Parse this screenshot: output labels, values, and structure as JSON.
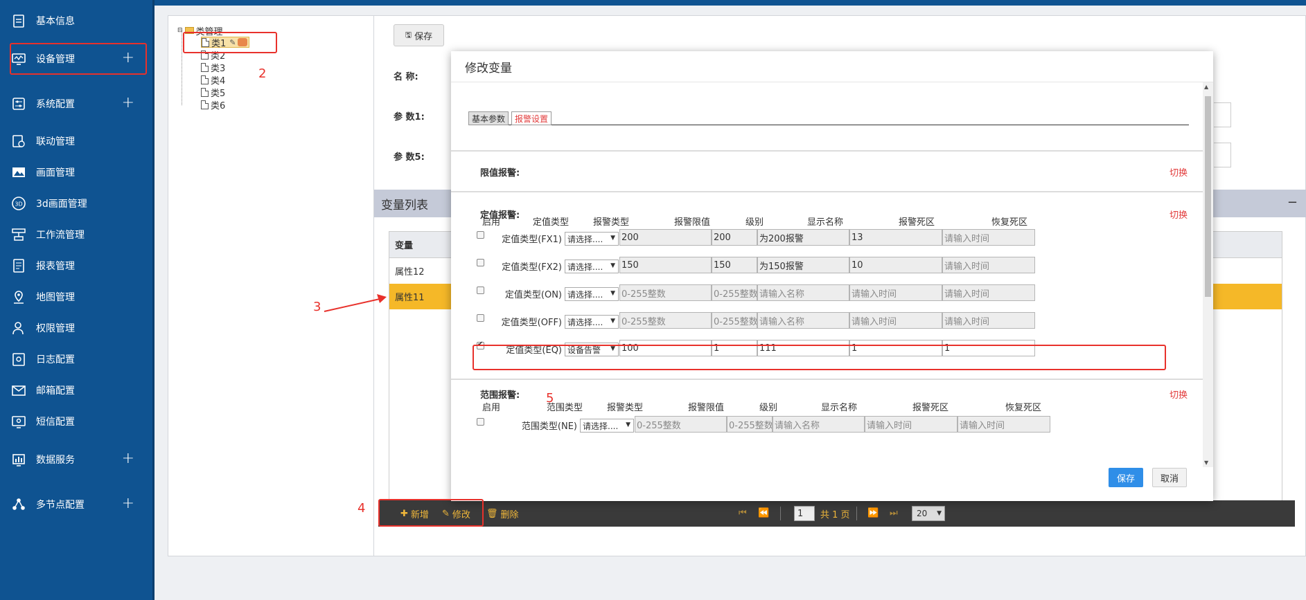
{
  "sidebar": {
    "items": [
      {
        "label": "基本信息",
        "icon": "calendar-icon",
        "plus": ""
      },
      {
        "label": "设备管理",
        "icon": "monitor-icon",
        "plus": "+"
      },
      {
        "label": "系统配置",
        "icon": "sliders-icon",
        "plus": "+"
      },
      {
        "label": "联动管理",
        "icon": "linkage-icon",
        "plus": ""
      },
      {
        "label": "画面管理",
        "icon": "image-icon",
        "plus": ""
      },
      {
        "label": "3d画面管理",
        "icon": "3d-icon",
        "plus": ""
      },
      {
        "label": "工作流管理",
        "icon": "workflow-icon",
        "plus": ""
      },
      {
        "label": "报表管理",
        "icon": "report-icon",
        "plus": ""
      },
      {
        "label": "地图管理",
        "icon": "map-pin-icon",
        "plus": ""
      },
      {
        "label": "权限管理",
        "icon": "user-icon",
        "plus": ""
      },
      {
        "label": "日志配置",
        "icon": "log-icon",
        "plus": ""
      },
      {
        "label": "邮箱配置",
        "icon": "mail-icon",
        "plus": ""
      },
      {
        "label": "短信配置",
        "icon": "sms-icon",
        "plus": ""
      },
      {
        "label": "数据服务",
        "icon": "chart-icon",
        "plus": "+"
      },
      {
        "label": "多节点配置",
        "icon": "nodes-icon",
        "plus": "+"
      }
    ]
  },
  "tree": {
    "root": "类管理",
    "children": [
      "类1",
      "类2",
      "类3",
      "类4",
      "类5",
      "类6"
    ]
  },
  "form": {
    "save_label": "保存",
    "name_label": "名  称:",
    "param1_label": "参  数1:",
    "param5_label": "参  数5:"
  },
  "varlist": {
    "title": "变量列表",
    "collapse": "−",
    "column": "变量",
    "rows": [
      "属性12",
      "属性11"
    ]
  },
  "pager": {
    "add": "新增",
    "edit": "修改",
    "delete": "删除",
    "page": "1",
    "total": "共 1 页",
    "page_size": "20"
  },
  "modal": {
    "title": "修改变量",
    "tabs": [
      "基本参数",
      "报警设置"
    ],
    "limit_alarm": "限值报警:",
    "fixed_alarm": "定值报警:",
    "range_alarm": "范围报警:",
    "switch": "切换",
    "fixed_columns": [
      "启用",
      "定值类型",
      "报警类型",
      "报警限值",
      "级别",
      "显示名称",
      "报警死区",
      "恢复死区"
    ],
    "range_columns": [
      "启用",
      "范围类型",
      "报警类型",
      "报警限值",
      "级别",
      "显示名称",
      "报警死区",
      "恢复死区"
    ],
    "fixed_rows": [
      {
        "checked": false,
        "label": "定值类型(FX1)",
        "alarm_type": "请选择....",
        "limit": "200",
        "level": "200",
        "name": "为200报警",
        "dead": "13",
        "recover": "请输入时间",
        "ph": [
          false,
          false,
          false,
          false,
          true
        ],
        "white": false
      },
      {
        "checked": false,
        "label": "定值类型(FX2)",
        "alarm_type": "请选择....",
        "limit": "150",
        "level": "150",
        "name": "为150报警",
        "dead": "10",
        "recover": "请输入时间",
        "ph": [
          false,
          false,
          false,
          false,
          true
        ],
        "white": false
      },
      {
        "checked": false,
        "label": "定值类型(ON)",
        "alarm_type": "请选择....",
        "limit": "0-255整数",
        "level": "0-255整数",
        "name": "请输入名称",
        "dead": "请输入时间",
        "recover": "请输入时间",
        "ph": [
          true,
          true,
          true,
          true,
          true
        ],
        "white": false
      },
      {
        "checked": false,
        "label": "定值类型(OFF)",
        "alarm_type": "请选择....",
        "limit": "0-255整数",
        "level": "0-255整数",
        "name": "请输入名称",
        "dead": "请输入时间",
        "recover": "请输入时间",
        "ph": [
          true,
          true,
          true,
          true,
          true
        ],
        "white": false
      },
      {
        "checked": true,
        "label": "定值类型(EQ)",
        "alarm_type": "设备告警",
        "limit": "100",
        "level": "1",
        "name": "111",
        "dead": "1",
        "recover": "1",
        "ph": [
          false,
          false,
          false,
          false,
          false
        ],
        "white": true
      }
    ],
    "range_rows": [
      {
        "checked": false,
        "label": "范围类型(NE)",
        "alarm_type": "请选择....",
        "limit": "0-255整数",
        "level": "0-255整数",
        "name": "请输入名称",
        "dead": "请输入时间",
        "recover": "请输入时间"
      }
    ],
    "save": "保存",
    "cancel": "取消"
  },
  "annotations": [
    "2",
    "3",
    "4",
    "5"
  ],
  "colors": {
    "sidebar": "#0f5391",
    "highlight": "#f5b828",
    "annotation": "#e8312b",
    "primary": "#2f8ee8"
  }
}
